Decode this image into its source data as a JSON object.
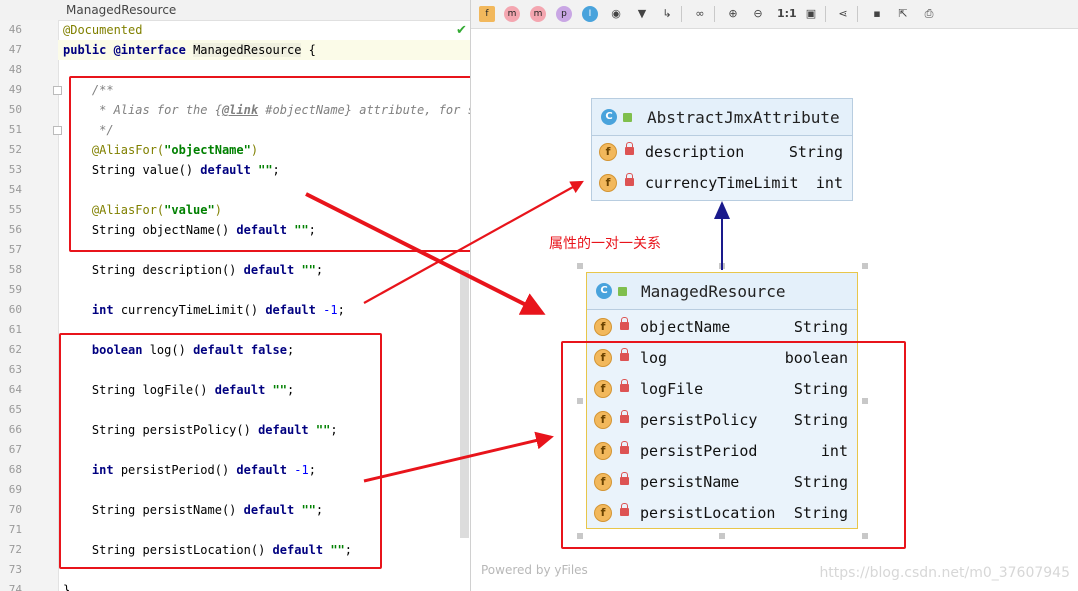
{
  "editor": {
    "tab_title": "ManagedResource",
    "lines": [
      {
        "no": "46",
        "segments": [
          {
            "t": "@Documented",
            "c": "ann"
          }
        ]
      },
      {
        "no": "47",
        "segments": [
          {
            "t": "public ",
            "c": "kw"
          },
          {
            "t": "@interface",
            "c": "kw"
          },
          {
            "t": " "
          },
          {
            "t": "ManagedResource",
            "c": "cls-hl"
          },
          {
            "t": " {"
          }
        ]
      },
      {
        "no": "48",
        "segments": []
      },
      {
        "no": "49",
        "segments": [
          {
            "t": "    /**",
            "c": "cmt"
          }
        ]
      },
      {
        "no": "50",
        "segments": [
          {
            "t": "     * Alias for the {",
            "c": "cmt"
          },
          {
            "t": "@link",
            "c": "cmt cmt-tag"
          },
          {
            "t": " #objectName} attribute, for si",
            "c": "cmt"
          }
        ]
      },
      {
        "no": "51",
        "segments": [
          {
            "t": "     */",
            "c": "cmt"
          }
        ]
      },
      {
        "no": "52",
        "segments": [
          {
            "t": "    "
          },
          {
            "t": "@AliasFor(",
            "c": "ann"
          },
          {
            "t": "\"objectName\"",
            "c": "str"
          },
          {
            "t": ")",
            "c": "ann"
          }
        ]
      },
      {
        "no": "53",
        "segments": [
          {
            "t": "    String value() "
          },
          {
            "t": "default",
            "c": "kw"
          },
          {
            "t": " "
          },
          {
            "t": "\"\"",
            "c": "str"
          },
          {
            "t": ";"
          }
        ]
      },
      {
        "no": "54",
        "segments": []
      },
      {
        "no": "55",
        "segments": [
          {
            "t": "    "
          },
          {
            "t": "@AliasFor(",
            "c": "ann"
          },
          {
            "t": "\"value\"",
            "c": "str"
          },
          {
            "t": ")",
            "c": "ann"
          }
        ]
      },
      {
        "no": "56",
        "segments": [
          {
            "t": "    String objectName() "
          },
          {
            "t": "default",
            "c": "kw"
          },
          {
            "t": " "
          },
          {
            "t": "\"\"",
            "c": "str"
          },
          {
            "t": ";"
          }
        ]
      },
      {
        "no": "57",
        "segments": []
      },
      {
        "no": "58",
        "segments": [
          {
            "t": "    String description() "
          },
          {
            "t": "default",
            "c": "kw"
          },
          {
            "t": " "
          },
          {
            "t": "\"\"",
            "c": "str"
          },
          {
            "t": ";"
          }
        ]
      },
      {
        "no": "59",
        "segments": []
      },
      {
        "no": "60",
        "segments": [
          {
            "t": "    "
          },
          {
            "t": "int",
            "c": "kw"
          },
          {
            "t": " currencyTimeLimit() "
          },
          {
            "t": "default",
            "c": "kw"
          },
          {
            "t": " "
          },
          {
            "t": "-1",
            "c": "num"
          },
          {
            "t": ";"
          }
        ]
      },
      {
        "no": "61",
        "segments": []
      },
      {
        "no": "62",
        "segments": [
          {
            "t": "    "
          },
          {
            "t": "boolean",
            "c": "kw"
          },
          {
            "t": " log() "
          },
          {
            "t": "default false",
            "c": "kw"
          },
          {
            "t": ";"
          }
        ]
      },
      {
        "no": "63",
        "segments": []
      },
      {
        "no": "64",
        "segments": [
          {
            "t": "    String logFile() "
          },
          {
            "t": "default",
            "c": "kw"
          },
          {
            "t": " "
          },
          {
            "t": "\"\"",
            "c": "str"
          },
          {
            "t": ";"
          }
        ]
      },
      {
        "no": "65",
        "segments": []
      },
      {
        "no": "66",
        "segments": [
          {
            "t": "    String persistPolicy() "
          },
          {
            "t": "default",
            "c": "kw"
          },
          {
            "t": " "
          },
          {
            "t": "\"\"",
            "c": "str"
          },
          {
            "t": ";"
          }
        ]
      },
      {
        "no": "67",
        "segments": []
      },
      {
        "no": "68",
        "segments": [
          {
            "t": "    "
          },
          {
            "t": "int",
            "c": "kw"
          },
          {
            "t": " persistPeriod() "
          },
          {
            "t": "default",
            "c": "kw"
          },
          {
            "t": " "
          },
          {
            "t": "-1",
            "c": "num"
          },
          {
            "t": ";"
          }
        ]
      },
      {
        "no": "69",
        "segments": []
      },
      {
        "no": "70",
        "segments": [
          {
            "t": "    String persistName() "
          },
          {
            "t": "default",
            "c": "kw"
          },
          {
            "t": " "
          },
          {
            "t": "\"\"",
            "c": "str"
          },
          {
            "t": ";"
          }
        ]
      },
      {
        "no": "71",
        "segments": []
      },
      {
        "no": "72",
        "segments": [
          {
            "t": "    String persistLocation() "
          },
          {
            "t": "default",
            "c": "kw"
          },
          {
            "t": " "
          },
          {
            "t": "\"\"",
            "c": "str"
          },
          {
            "t": ";"
          }
        ]
      },
      {
        "no": "73",
        "segments": []
      },
      {
        "no": "74",
        "segments": [
          {
            "t": "}"
          }
        ]
      }
    ]
  },
  "toolbar": {
    "badges": [
      "f",
      "m",
      "m",
      "p",
      "I"
    ],
    "actual_size_label": "1:1"
  },
  "diagram": {
    "parent": {
      "name": "AbstractJmxAttribute",
      "fields": [
        {
          "name": "description",
          "type": "String"
        },
        {
          "name": "currencyTimeLimit",
          "type": "int"
        }
      ]
    },
    "child": {
      "name": "ManagedResource",
      "fields": [
        {
          "name": "objectName",
          "type": "String"
        },
        {
          "name": "log",
          "type": "boolean"
        },
        {
          "name": "logFile",
          "type": "String"
        },
        {
          "name": "persistPolicy",
          "type": "String"
        },
        {
          "name": "persistPeriod",
          "type": "int"
        },
        {
          "name": "persistName",
          "type": "String"
        },
        {
          "name": "persistLocation",
          "type": "String"
        }
      ]
    },
    "class_badge": "C",
    "field_badge": "f",
    "relation_label": "属性的一对一关系",
    "powered_by": "Powered by yFiles",
    "watermark": "https://blog.csdn.net/m0_37607945"
  },
  "colors": {
    "annotation_red": "#e8141b",
    "inheritance_arrow": "#1a1a8c",
    "selection_border": "#e8c64a"
  }
}
